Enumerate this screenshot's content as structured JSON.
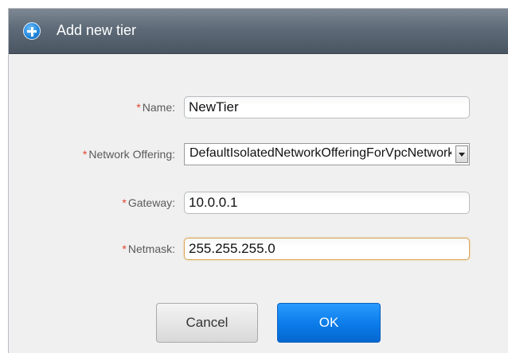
{
  "dialog": {
    "title": "Add new tier",
    "title_icon": "plus-circle-icon"
  },
  "form": {
    "required_marker": "*",
    "name": {
      "label": "Name:",
      "value": "NewTier"
    },
    "network_offering": {
      "label": "Network Offering:",
      "selected": "DefaultIsolatedNetworkOfferingForVpcNetworks"
    },
    "gateway": {
      "label": "Gateway:",
      "value": "10.0.0.1"
    },
    "netmask": {
      "label": "Netmask:",
      "value": "255.255.255.0"
    }
  },
  "buttons": {
    "cancel": "Cancel",
    "ok": "OK"
  },
  "colors": {
    "accent": "#0a7be8",
    "required": "#e0452f",
    "titlebar": "#5e6a77"
  }
}
